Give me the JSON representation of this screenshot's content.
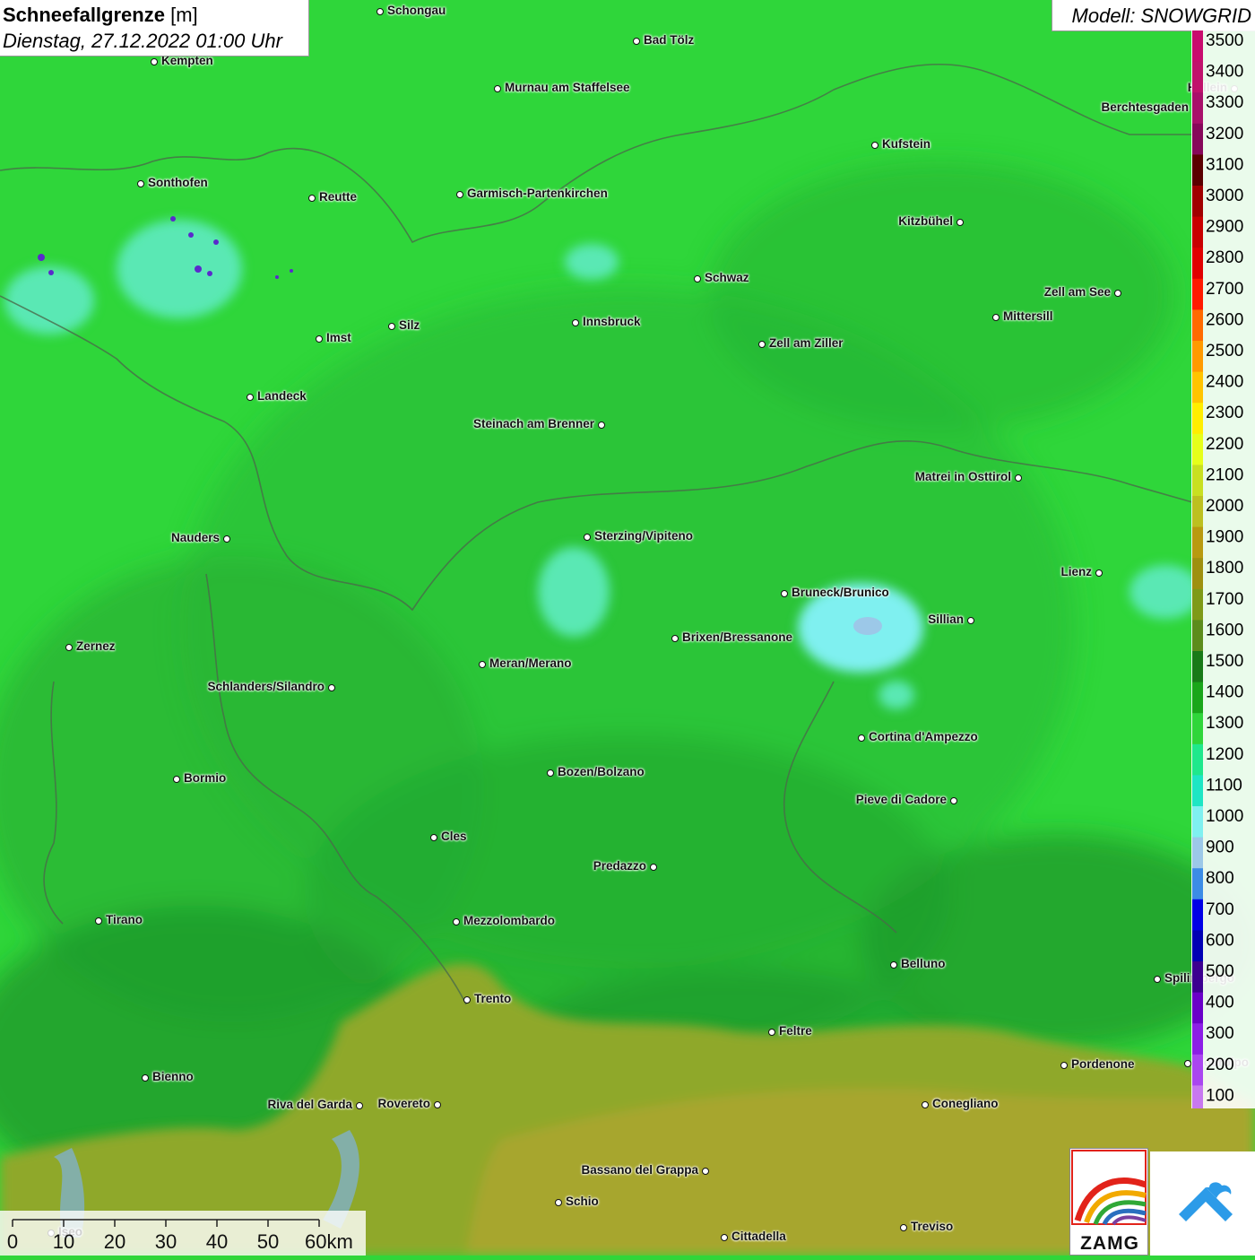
{
  "title": {
    "label": "Schneefallgrenze",
    "unit": "[m]",
    "datetime": "Dienstag, 27.12.2022 01:00 Uhr"
  },
  "model": "Modell: SNOWGRID",
  "legend": {
    "ticks": [
      "3500",
      "3400",
      "3300",
      "3200",
      "3100",
      "3000",
      "2900",
      "2800",
      "2700",
      "2600",
      "2500",
      "2400",
      "2300",
      "2200",
      "2100",
      "2000",
      "1900",
      "1800",
      "1700",
      "1600",
      "1500",
      "1400",
      "1300",
      "1200",
      "1100",
      "1000",
      "900",
      "800",
      "700",
      "600",
      "500",
      "400",
      "300",
      "200",
      "100"
    ],
    "colors": [
      "#c80c6e",
      "#c0126c",
      "#a8106a",
      "#86085a",
      "#5a0000",
      "#a00000",
      "#c80000",
      "#e00000",
      "#ff1a00",
      "#ff6a00",
      "#ff9a00",
      "#ffc400",
      "#ffee00",
      "#e6ff1a",
      "#c8e020",
      "#bcc020",
      "#b89a10",
      "#9e9010",
      "#7e9a18",
      "#5c8c1c",
      "#187a18",
      "#1aa61a",
      "#2fd63a",
      "#1fe88c",
      "#1ee6c4",
      "#7ff0f0",
      "#9cc8e8",
      "#3c8ce6",
      "#0000e6",
      "#0000b4",
      "#3c0090",
      "#6a00c8",
      "#8c1ee6",
      "#aa46f0",
      "#c878f0"
    ]
  },
  "scale": {
    "ticks": [
      "0",
      "10",
      "20",
      "30",
      "40",
      "50",
      "60km"
    ]
  },
  "logo": {
    "text": "ZAMG"
  },
  "places": [
    {
      "name": "Schongau",
      "label_side": "right"
    },
    {
      "name": "Bad Tölz",
      "label_side": "right"
    },
    {
      "name": "Kempten",
      "label_side": "right"
    },
    {
      "name": "Murnau am Staffelsee",
      "label_side": "right"
    },
    {
      "name": "Hallein",
      "label_side": "left"
    },
    {
      "name": "Berchtesgaden",
      "label_side": "left"
    },
    {
      "name": "Kufstein",
      "label_side": "right"
    },
    {
      "name": "Sonthofen",
      "label_side": "right"
    },
    {
      "name": "Reutte",
      "label_side": "right"
    },
    {
      "name": "Garmisch-Partenkirchen",
      "label_side": "right"
    },
    {
      "name": "Kitzbühel",
      "label_side": "left"
    },
    {
      "name": "Schwaz",
      "label_side": "right"
    },
    {
      "name": "Zell am See",
      "label_side": "left"
    },
    {
      "name": "Innsbruck",
      "label_side": "right"
    },
    {
      "name": "Mittersill",
      "label_side": "right"
    },
    {
      "name": "Silz",
      "label_side": "right"
    },
    {
      "name": "Imst",
      "label_side": "right"
    },
    {
      "name": "Zell am Ziller",
      "label_side": "right"
    },
    {
      "name": "Landeck",
      "label_side": "right"
    },
    {
      "name": "Steinach am Brenner",
      "label_side": "left"
    },
    {
      "name": "Matrei in Osttirol",
      "label_side": "left"
    },
    {
      "name": "Nauders",
      "label_side": "left"
    },
    {
      "name": "Sterzing/Vipiteno",
      "label_side": "right"
    },
    {
      "name": "Lienz",
      "label_side": "left"
    },
    {
      "name": "Bruneck/Brunico",
      "label_side": "right"
    },
    {
      "name": "Sillian",
      "label_side": "left"
    },
    {
      "name": "Zernez",
      "label_side": "right"
    },
    {
      "name": "Brixen/Bressanone",
      "label_side": "right"
    },
    {
      "name": "Meran/Merano",
      "label_side": "right"
    },
    {
      "name": "Schlanders/Silandro",
      "label_side": "left"
    },
    {
      "name": "Cortina d'Ampezzo",
      "label_side": "right"
    },
    {
      "name": "Bozen/Bolzano",
      "label_side": "right"
    },
    {
      "name": "Bormio",
      "label_side": "right"
    },
    {
      "name": "Pieve di Cadore",
      "label_side": "left"
    },
    {
      "name": "Cles",
      "label_side": "right"
    },
    {
      "name": "Predazzo",
      "label_side": "left"
    },
    {
      "name": "Tirano",
      "label_side": "right"
    },
    {
      "name": "Mezzolombardo",
      "label_side": "right"
    },
    {
      "name": "Belluno",
      "label_side": "right"
    },
    {
      "name": "Spilimbergo",
      "label_side": "right"
    },
    {
      "name": "Trento",
      "label_side": "right"
    },
    {
      "name": "Feltre",
      "label_side": "right"
    },
    {
      "name": "Pordenone",
      "label_side": "right"
    },
    {
      "name": "Codroipo",
      "label_side": "right"
    },
    {
      "name": "Bienno",
      "label_side": "right"
    },
    {
      "name": "Riva del Garda",
      "label_side": "left"
    },
    {
      "name": "Rovereto",
      "label_side": "left"
    },
    {
      "name": "Conegliano",
      "label_side": "right"
    },
    {
      "name": "Bassano del Grappa",
      "label_side": "left"
    },
    {
      "name": "Schio",
      "label_side": "right"
    },
    {
      "name": "Treviso",
      "label_side": "right"
    },
    {
      "name": "Cittadella",
      "label_side": "right"
    },
    {
      "name": "Iseo",
      "label_side": "right"
    }
  ]
}
